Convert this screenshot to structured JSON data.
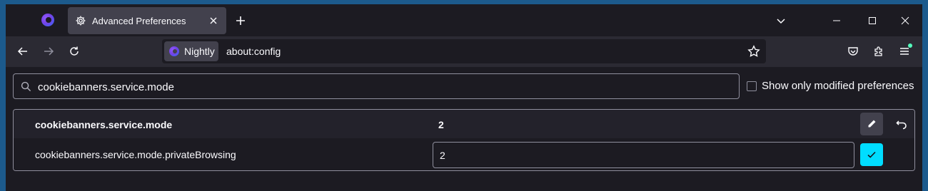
{
  "tab": {
    "title": "Advanced Preferences"
  },
  "urlbar": {
    "identity_label": "Nightly",
    "url": "about:config"
  },
  "search": {
    "value": "cookiebanners.service.mode",
    "modified_label": "Show only modified preferences"
  },
  "prefs": [
    {
      "name": "cookiebanners.service.mode",
      "value": "2",
      "modified": true
    },
    {
      "name": "cookiebanners.service.mode.privateBrowsing",
      "value": "2",
      "editing": true
    }
  ],
  "colors": {
    "accent": "#00ddff",
    "tab_bg": "#42414d",
    "toolbar_bg": "#2b2a33",
    "content_bg": "#1c1b22"
  },
  "icons": [
    "firefox-icon",
    "gear-icon",
    "close-icon",
    "plus-icon",
    "chevron-down-icon",
    "minimize-icon",
    "maximize-icon",
    "back-icon",
    "forward-icon",
    "reload-icon",
    "star-icon",
    "pocket-icon",
    "extensions-icon",
    "menu-icon",
    "search-icon",
    "pencil-icon",
    "undo-icon",
    "checkmark-icon"
  ]
}
